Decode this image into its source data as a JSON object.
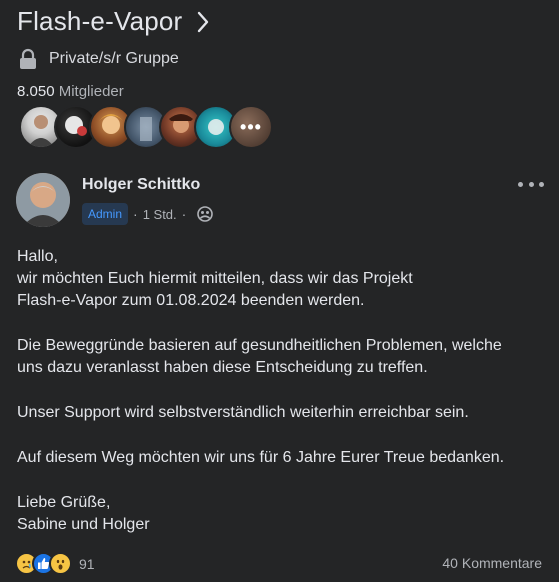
{
  "group": {
    "title": "Flash-e-Vapor",
    "privacy": "Private/s/r Gruppe",
    "member_count": "8.050",
    "member_label": "Mitglieder",
    "more_members_label": "•••"
  },
  "post": {
    "author": "Holger Schittko",
    "role_badge": "Admin",
    "separator": "·",
    "time": "1 Std.",
    "body": {
      "greeting": "Hallo,",
      "line1": "wir möchten Euch hiermit mitteilen, dass wir das Projekt",
      "line2": "Flash-e-Vapor zum 01.08.2024 beenden werden.",
      "para2_line1": "Die Beweggründe basieren auf gesundheitlichen Problemen, welche",
      "para2_line2": "uns dazu veranlasst haben diese Entscheidung zu treffen.",
      "para3": "Unser Support wird selbstverständlich weiterhin erreichbar sein.",
      "para4": "Auf diesem Weg möchten wir uns für 6 Jahre Eurer Treue bedanken.",
      "closing1": "Liebe Grüße,",
      "closing2": "Sabine und Holger"
    }
  },
  "footer": {
    "reactions": [
      "sad",
      "like",
      "wow"
    ],
    "reaction_count": "91",
    "comments": "40 Kommentare"
  },
  "colors": {
    "background": "#242526",
    "text": "#e4e6eb",
    "secondary_text": "#b0b3b8",
    "admin_badge_bg": "#263951",
    "admin_badge_text": "#4599ff"
  }
}
